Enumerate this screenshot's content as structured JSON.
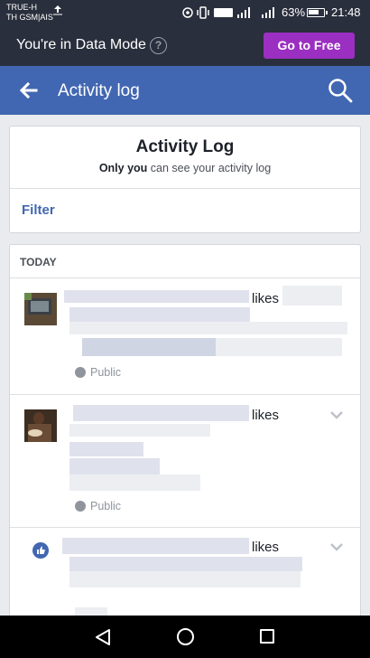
{
  "status_bar": {
    "carrier_line1": "TRUE-H",
    "carrier_line2": "TH GSM|AIS",
    "network_badge": "VoLTE",
    "signal_badge": "4G",
    "battery": "63%",
    "time": "21:48"
  },
  "data_mode": {
    "text": "You're in Data Mode",
    "help_symbol": "?",
    "go_free_label": "Go to Free"
  },
  "nav": {
    "title": "Activity log",
    "back_icon": "back-arrow-icon",
    "search_icon": "search-icon"
  },
  "header_card": {
    "title": "Activity Log",
    "subtitle_bold": "Only you",
    "subtitle_rest": " can see your activity log",
    "filter_label": "Filter"
  },
  "feed": {
    "section": "TODAY",
    "entries": [
      {
        "verb": "likes",
        "privacy": "Public"
      },
      {
        "verb": "likes",
        "privacy": "Public"
      },
      {
        "verb": "likes"
      }
    ]
  },
  "colors": {
    "nav_blue": "#4267b2",
    "go_free_purple": "#9b2fc1",
    "dark_bar": "#2a2f3d"
  }
}
